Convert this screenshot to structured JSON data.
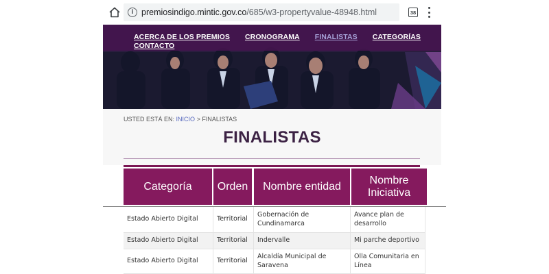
{
  "browser": {
    "url_host": "premiosindigo.mintic.gov.co",
    "url_path": "/685/w3-propertyvalue-48948.html",
    "tab_count": "38"
  },
  "nav": {
    "items": [
      {
        "label": "ACERCA DE LOS PREMIOS",
        "active": false
      },
      {
        "label": "CRONOGRAMA",
        "active": false
      },
      {
        "label": "FINALISTAS",
        "active": true
      },
      {
        "label": "CATEGORÍAS",
        "active": false
      },
      {
        "label": "CONTACTO",
        "active": false
      }
    ]
  },
  "breadcrumb": {
    "prefix": "USTED ESTÁ EN:",
    "home": "INICIO",
    "separator": ">",
    "current": "FINALISTAS"
  },
  "page": {
    "title": "FINALISTAS"
  },
  "table": {
    "headers": [
      "Categoría",
      "Orden",
      "Nombre entidad",
      "Nombre Iniciativa"
    ],
    "rows": [
      [
        "Estado Abierto Digital",
        "Territorial",
        "Gobernación de Cundinamarca",
        "Avance plan de desarrollo"
      ],
      [
        "Estado Abierto Digital",
        "Territorial",
        "Indervalle",
        "Mi parche deportivo"
      ],
      [
        "Estado Abierto Digital",
        "Territorial",
        "Alcaldía Municipal de Saravena",
        "Olla Comunitaria en Línea"
      ]
    ]
  },
  "colors": {
    "header_bg": "#851a5e",
    "title": "#3c2244",
    "active_nav": "#a7a2d8"
  }
}
